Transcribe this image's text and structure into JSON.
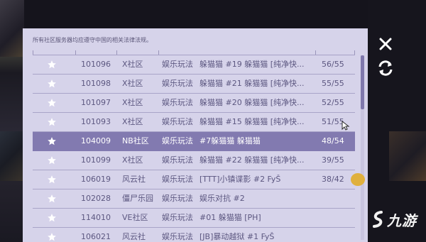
{
  "notice": "所有社区服务器均应遵守中国的相关法律法规。",
  "rows": [
    {
      "id": "101096",
      "zone": "X社区",
      "category": "娱乐玩法",
      "name": "躲猫猫 #19 躲猫猫 [纯净快...",
      "count": "56/55",
      "selected": false
    },
    {
      "id": "101098",
      "zone": "X社区",
      "category": "娱乐玩法",
      "name": "躲猫猫 #21 躲猫猫 [纯净快...",
      "count": "55/55",
      "selected": false
    },
    {
      "id": "101097",
      "zone": "X社区",
      "category": "娱乐玩法",
      "name": "躲猫猫 #20 躲猫猫 [纯净快...",
      "count": "52/55",
      "selected": false
    },
    {
      "id": "101093",
      "zone": "X社区",
      "category": "娱乐玩法",
      "name": "躲猫猫 #15 躲猫猫 [纯净快...",
      "count": "51/55",
      "selected": false
    },
    {
      "id": "104009",
      "zone": "NB社区",
      "category": "娱乐玩法",
      "name": "#7躲猫猫 躲猫猫",
      "count": "48/54",
      "selected": true
    },
    {
      "id": "101099",
      "zone": "X社区",
      "category": "娱乐玩法",
      "name": "躲猫猫 #22 躲猫猫 [纯净快...",
      "count": "39/55",
      "selected": false
    },
    {
      "id": "106019",
      "zone": "风云社",
      "category": "娱乐玩法",
      "name": "[TTT]小镇谍影 #2 FyŠ",
      "count": "38/42",
      "selected": false
    },
    {
      "id": "102028",
      "zone": "僵尸乐园",
      "category": "娱乐玩法",
      "name": "娱乐对抗 #2",
      "count": "",
      "selected": false
    },
    {
      "id": "114010",
      "zone": "VE社区",
      "category": "娱乐玩法",
      "name": "#01 躲猫猫 [PH]",
      "count": "",
      "selected": false
    },
    {
      "id": "106021",
      "zone": "风云社",
      "category": "娱乐玩法",
      "name": "[JB]暴动越狱 #1 FyŠ",
      "count": "",
      "selected": false
    }
  ],
  "icons": {
    "close": "close-icon",
    "refresh": "refresh-icon",
    "favorite": "star-icon",
    "logo": "jiuyou-logo"
  },
  "logo_text": "九游",
  "colors": {
    "panel": "#d6d3ea",
    "row_text": "#5c5780",
    "selected_bg": "#827ab0",
    "accent_logo": "#f2f2f2"
  }
}
